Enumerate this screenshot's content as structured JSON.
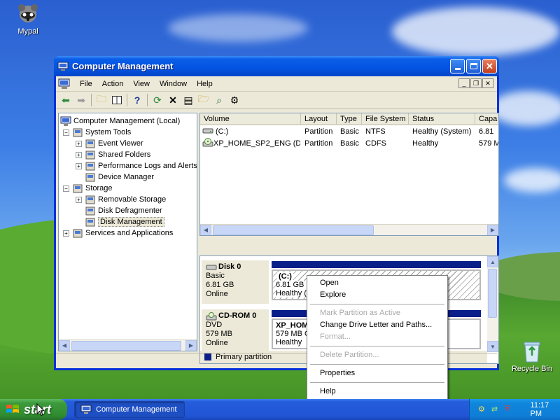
{
  "desktop": {
    "icons": [
      {
        "label": "Mypal",
        "icon": "raccoon-icon"
      },
      {
        "label": "Recycle Bin",
        "icon": "recycle-bin-icon"
      }
    ]
  },
  "window": {
    "title": "Computer Management",
    "menu": [
      "File",
      "Action",
      "View",
      "Window",
      "Help"
    ],
    "toolbar_icons": [
      "back-arrow-icon",
      "forward-arrow-icon",
      "up-folder-icon",
      "show-hide-tree-icon",
      "help-icon",
      "refresh-icon",
      "delete-icon",
      "properties-icon",
      "open-icon",
      "search-icon",
      "settings-icon"
    ]
  },
  "tree": {
    "root": "Computer Management (Local)",
    "items": [
      {
        "label": "System Tools",
        "expander": "−",
        "level": 1
      },
      {
        "label": "Event Viewer",
        "expander": "+",
        "level": 2
      },
      {
        "label": "Shared Folders",
        "expander": "+",
        "level": 2
      },
      {
        "label": "Performance Logs and Alerts",
        "expander": "+",
        "level": 2
      },
      {
        "label": "Device Manager",
        "expander": "",
        "level": 2
      },
      {
        "label": "Storage",
        "expander": "−",
        "level": 1
      },
      {
        "label": "Removable Storage",
        "expander": "+",
        "level": 2
      },
      {
        "label": "Disk Defragmenter",
        "expander": "",
        "level": 2
      },
      {
        "label": "Disk Management",
        "expander": "",
        "level": 2,
        "selected": true
      },
      {
        "label": "Services and Applications",
        "expander": "+",
        "level": 1
      }
    ]
  },
  "volumes": {
    "headers": [
      "Volume",
      "Layout",
      "Type",
      "File System",
      "Status",
      "Capa"
    ],
    "rows": [
      [
        "(C:)",
        "Partition",
        "Basic",
        "NTFS",
        "Healthy (System)",
        "6.81"
      ],
      [
        "XP_HOME_SP2_ENG (D:)",
        "Partition",
        "Basic",
        "CDFS",
        "Healthy",
        "579 M"
      ]
    ]
  },
  "disks": [
    {
      "name": "Disk 0",
      "type": "Basic",
      "size": "6.81 GB",
      "status": "Online",
      "partition": {
        "name": "(C:)",
        "detail": "6.81 GB NTFS",
        "status": "Healthy ("
      }
    },
    {
      "name": "CD-ROM 0",
      "type": "DVD",
      "size": "579 MB",
      "status": "Online",
      "partition": {
        "name": "XP_HOM",
        "detail": "579 MB C",
        "status": "Healthy"
      }
    }
  ],
  "legend": {
    "label": "Primary partition",
    "color": "#0a1e8a"
  },
  "context_menu": [
    {
      "label": "Open",
      "enabled": true
    },
    {
      "label": "Explore",
      "enabled": true
    },
    {
      "sep": true
    },
    {
      "label": "Mark Partition as Active",
      "enabled": false
    },
    {
      "label": "Change Drive Letter and Paths...",
      "enabled": true
    },
    {
      "label": "Format...",
      "enabled": false
    },
    {
      "sep": true
    },
    {
      "label": "Delete Partition...",
      "enabled": false
    },
    {
      "sep": true
    },
    {
      "label": "Properties",
      "enabled": true
    },
    {
      "sep": true
    },
    {
      "label": "Help",
      "enabled": true
    }
  ],
  "taskbar": {
    "start_label": "start",
    "task_label": "Computer Management",
    "clock": "11:17 PM"
  }
}
